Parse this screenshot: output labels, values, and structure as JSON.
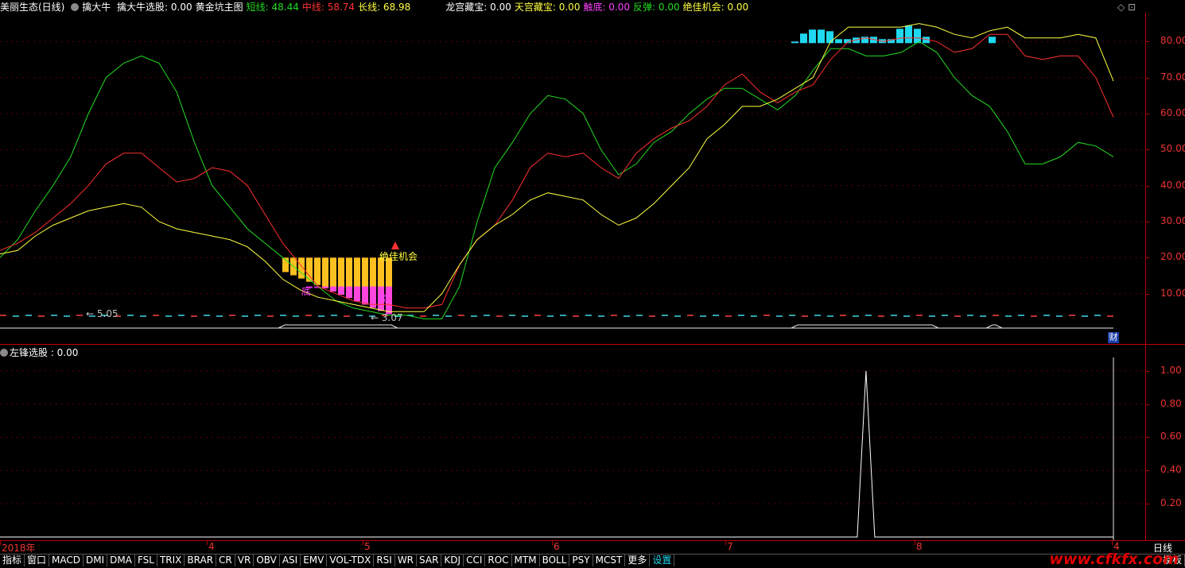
{
  "header": {
    "stock_name": "美丽生态(日线)",
    "indicator_name": "擒大牛",
    "items": [
      {
        "label": "擒大牛选股: 0.00",
        "color": "#ffffff"
      },
      {
        "label": "黄金坑主图",
        "color": "#ffffff"
      },
      {
        "label": "短线: 48.44",
        "color": "#22dd22"
      },
      {
        "label": "中线: 58.74",
        "color": "#ff3030"
      },
      {
        "label": "长线: 68.98",
        "color": "#ffff40"
      },
      {
        "label": "龙宫藏宝: 0.00",
        "color": "#ffffff"
      },
      {
        "label": "天宫藏宝: 0.00",
        "color": "#ffff40"
      },
      {
        "label": "触底: 0.00",
        "color": "#ff40ff"
      },
      {
        "label": "反弹: 0.00",
        "color": "#22dd22"
      },
      {
        "label": "绝佳机会: 0.00",
        "color": "#ffff40"
      }
    ]
  },
  "window_controls": {
    "diamond": "◇",
    "restore": "⊡"
  },
  "main_axis": {
    "labels": [
      "80.00",
      "70.00",
      "60.00",
      "50.00",
      "40.00",
      "30.00",
      "20.00",
      "10.00"
    ]
  },
  "sub_title": "左锋选股 : 0.00",
  "sub_axis": {
    "labels": [
      "1.00",
      "0.80",
      "0.60",
      "0.40",
      "0.20"
    ]
  },
  "annotations": {
    "opportunity": "绝佳机会",
    "bottom1": "底",
    "bottom2": "底",
    "low_marker": "5.05",
    "low_marker2": "3.07",
    "cai": "财"
  },
  "dates": [
    {
      "label": "2018年"
    },
    {
      "label": "4"
    },
    {
      "label": "5"
    },
    {
      "label": "6"
    },
    {
      "label": "7"
    },
    {
      "label": "8"
    },
    {
      "label": "4"
    }
  ],
  "period_label": "日线",
  "tabs": [
    "指标",
    "窗口",
    "MACD",
    "DMI",
    "DMA",
    "FSL",
    "TRIX",
    "BRAR",
    "CR",
    "VR",
    "OBV",
    "ASI",
    "EMV",
    "VOL-TDX",
    "RSI",
    "WR",
    "SAR",
    "KDJ",
    "CCI",
    "ROC",
    "MTM",
    "BOLL",
    "PSY",
    "MCST",
    "更多",
    "设置"
  ],
  "watermark": "www.cfkfx.com",
  "bottom_right_label": "模板",
  "chart_data": [
    {
      "type": "line",
      "title": "黄金坑主图",
      "ylim": [
        0,
        88
      ],
      "series": [
        {
          "name": "短线",
          "color": "#22dd22",
          "values": [
            20,
            25,
            33,
            40,
            48,
            60,
            70,
            74,
            76,
            74,
            66,
            52,
            40,
            34,
            28,
            24,
            20,
            16,
            12,
            8,
            6,
            5,
            4,
            4,
            3,
            3,
            12,
            30,
            45,
            52,
            60,
            65,
            64,
            60,
            50,
            43,
            46,
            52,
            55,
            60,
            64,
            67,
            67,
            64,
            61,
            65,
            72,
            78,
            78,
            76,
            76,
            77,
            80,
            77,
            70,
            65,
            62,
            55,
            46,
            46,
            48,
            52,
            51,
            48
          ]
        },
        {
          "name": "中线",
          "color": "#ff3030",
          "values": [
            22,
            24,
            27,
            31,
            35,
            40,
            46,
            49,
            49,
            45,
            41,
            42,
            45,
            44,
            40,
            32,
            24,
            18,
            12,
            10,
            8,
            7,
            7,
            6,
            6,
            7,
            18,
            25,
            29,
            36,
            45,
            49,
            48,
            49,
            45,
            42,
            49,
            53,
            56,
            58,
            62,
            68,
            71,
            66,
            63,
            66,
            68,
            75,
            80,
            81,
            80,
            81,
            81,
            80,
            77,
            78,
            82,
            82,
            76,
            75,
            76,
            76,
            70,
            59
          ]
        },
        {
          "name": "长线",
          "color": "#ffff40",
          "values": [
            21,
            22,
            26,
            29,
            31,
            33,
            34,
            35,
            34,
            30,
            28,
            27,
            26,
            25,
            23,
            19,
            14,
            11,
            9,
            8,
            7,
            6,
            5,
            5,
            5,
            10,
            18,
            25,
            29,
            32,
            36,
            38,
            37,
            36,
            32,
            29,
            31,
            35,
            40,
            45,
            53,
            57,
            62,
            62,
            64,
            67,
            70,
            80,
            84,
            84,
            84,
            84,
            85,
            84,
            82,
            81,
            83,
            84,
            81,
            81,
            81,
            82,
            81,
            69
          ]
        }
      ]
    },
    {
      "type": "line",
      "title": "左锋选股",
      "ylim": [
        0,
        1.08
      ],
      "series": [
        {
          "name": "左锋选股",
          "color": "#ffffff",
          "peak_index": 49,
          "values": [
            0,
            0,
            1,
            0,
            0
          ]
        }
      ]
    }
  ]
}
